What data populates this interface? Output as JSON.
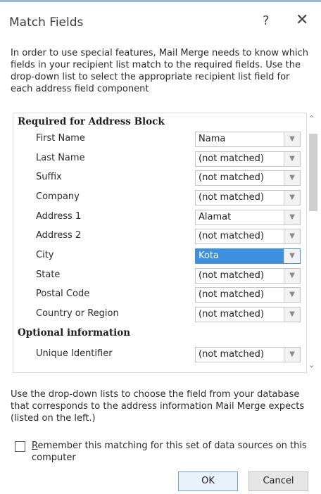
{
  "dialog": {
    "title": "Match Fields",
    "help_glyph": "?",
    "close_glyph": "✕",
    "intro": "In order to use special features, Mail Merge needs to know which fields in your recipient list match to the required fields.  Use the drop-down list to select the appropriate recipient list field for each address field component"
  },
  "sections": {
    "required": "Required for Address Block",
    "optional": "Optional information"
  },
  "fields": [
    {
      "label": "First Name",
      "value": "Nama"
    },
    {
      "label": "Last Name",
      "value": "(not matched)"
    },
    {
      "label": "Suffix",
      "value": "(not matched)"
    },
    {
      "label": "Company",
      "value": "(not matched)"
    },
    {
      "label": "Address 1",
      "value": "Alamat"
    },
    {
      "label": "Address 2",
      "value": "(not matched)"
    },
    {
      "label": "City",
      "value": "Kota",
      "selected": true
    },
    {
      "label": "State",
      "value": "(not matched)"
    },
    {
      "label": "Postal Code",
      "value": "(not matched)"
    },
    {
      "label": "Country or Region",
      "value": "(not matched)"
    }
  ],
  "optional_fields": [
    {
      "label": "Unique Identifier",
      "value": "(not matched)"
    }
  ],
  "footer": {
    "help": "Use the drop-down lists to choose the field from your database that corresponds to the address information Mail Merge expects (listed on the left.)",
    "remember_first": "R",
    "remember_rest": "emember this matching for this set of data sources on this computer",
    "remember_checked": false
  },
  "buttons": {
    "ok": "OK",
    "cancel": "Cancel"
  },
  "colors": {
    "selected": "#3d8fe0",
    "scrollbar_thumb": "#cfcfcf"
  }
}
